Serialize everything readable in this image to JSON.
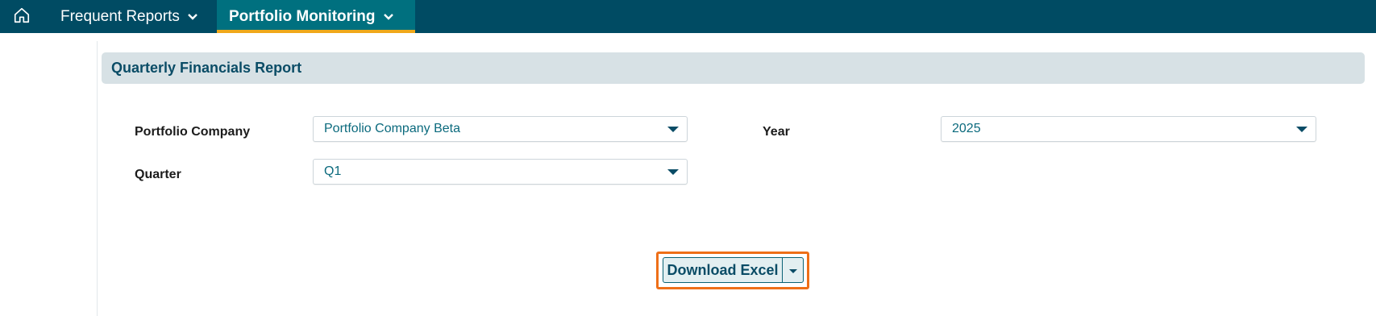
{
  "nav": {
    "home_icon": "home-icon",
    "items": [
      {
        "label": "Frequent Reports",
        "icon": "chevron-down-icon"
      },
      {
        "label": "Portfolio Monitoring",
        "icon": "chevron-down-icon",
        "active": true
      }
    ]
  },
  "panel": {
    "title": "Quarterly Financials Report"
  },
  "form": {
    "portfolio_company": {
      "label": "Portfolio Company",
      "value": "Portfolio Company Beta"
    },
    "year": {
      "label": "Year",
      "value": "2025"
    },
    "quarter": {
      "label": "Quarter",
      "value": "Q1"
    }
  },
  "actions": {
    "download_label": "Download Excel"
  },
  "colors": {
    "topbar": "#004b63",
    "active_tab": "#00707f",
    "active_underline": "#f0a81a",
    "highlight": "#ee6f18",
    "header_bg": "#d7e1e5"
  }
}
